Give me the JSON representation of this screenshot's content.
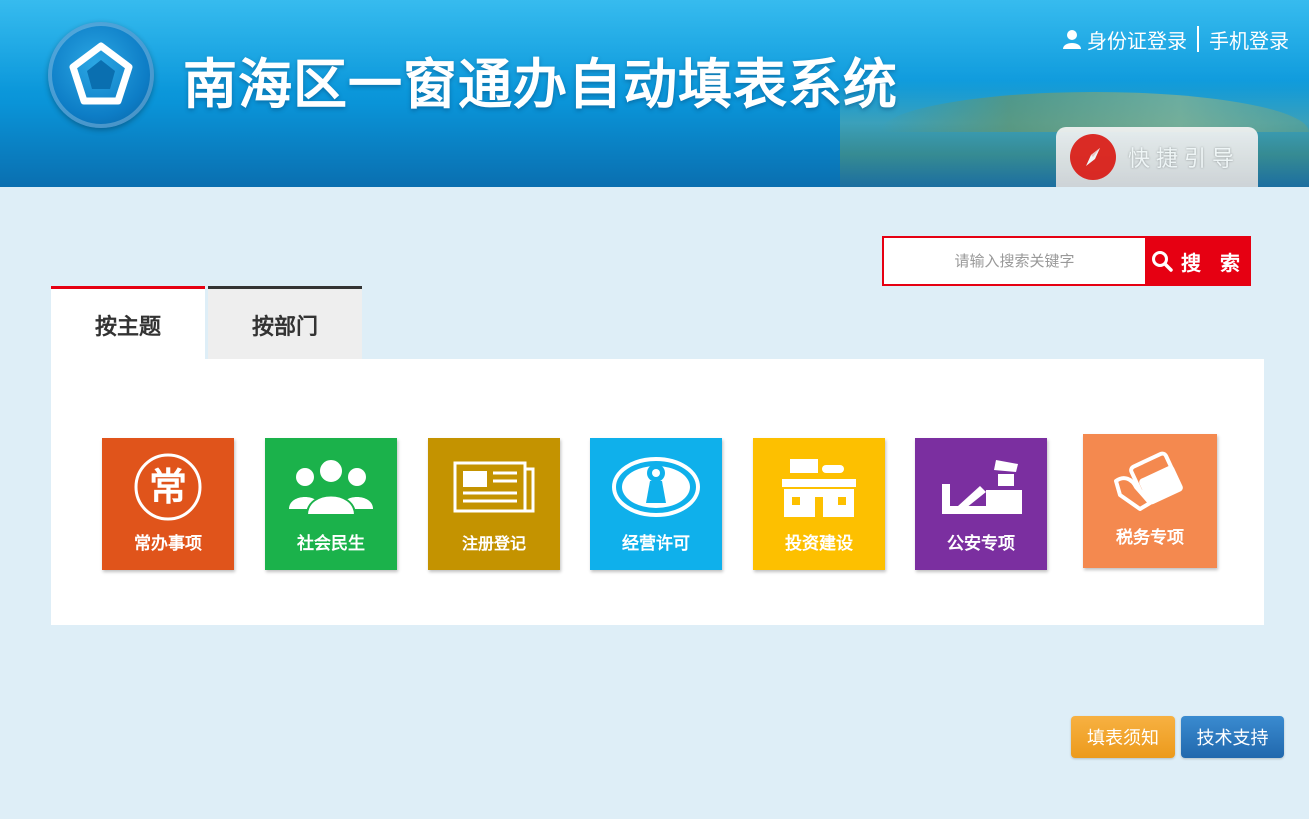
{
  "header": {
    "title": "南海区一窗通办自动填表系统",
    "id_login": "身份证登录",
    "phone_login": "手机登录",
    "guide_label": "快捷引导",
    "logo": "pentagon-logo-icon"
  },
  "search": {
    "placeholder": "请输入搜索关键字",
    "button_label": "搜 索",
    "accent": "#e60012"
  },
  "tabs": [
    {
      "label": "按主题",
      "active": true
    },
    {
      "label": "按部门",
      "active": false
    }
  ],
  "categories": [
    {
      "label": "常办事项",
      "icon": "chang-circle-icon",
      "color": "#e0541b"
    },
    {
      "label": "社会民生",
      "icon": "people-group-icon",
      "color": "#1bb24b"
    },
    {
      "label": "注册登记",
      "icon": "newspaper-icon",
      "color": "#c49300"
    },
    {
      "label": "经营许可",
      "icon": "medal-oval-icon",
      "color": "#0fb0eb"
    },
    {
      "label": "投资建设",
      "icon": "building-icon",
      "color": "#fdc000"
    },
    {
      "label": "公安专项",
      "icon": "police-icon",
      "color": "#7b2fa0"
    },
    {
      "label": "税务专项",
      "icon": "tax-hand-icon",
      "color": "#f4894f"
    }
  ],
  "footer": {
    "notice_label": "填表须知",
    "support_label": "技术支持"
  }
}
